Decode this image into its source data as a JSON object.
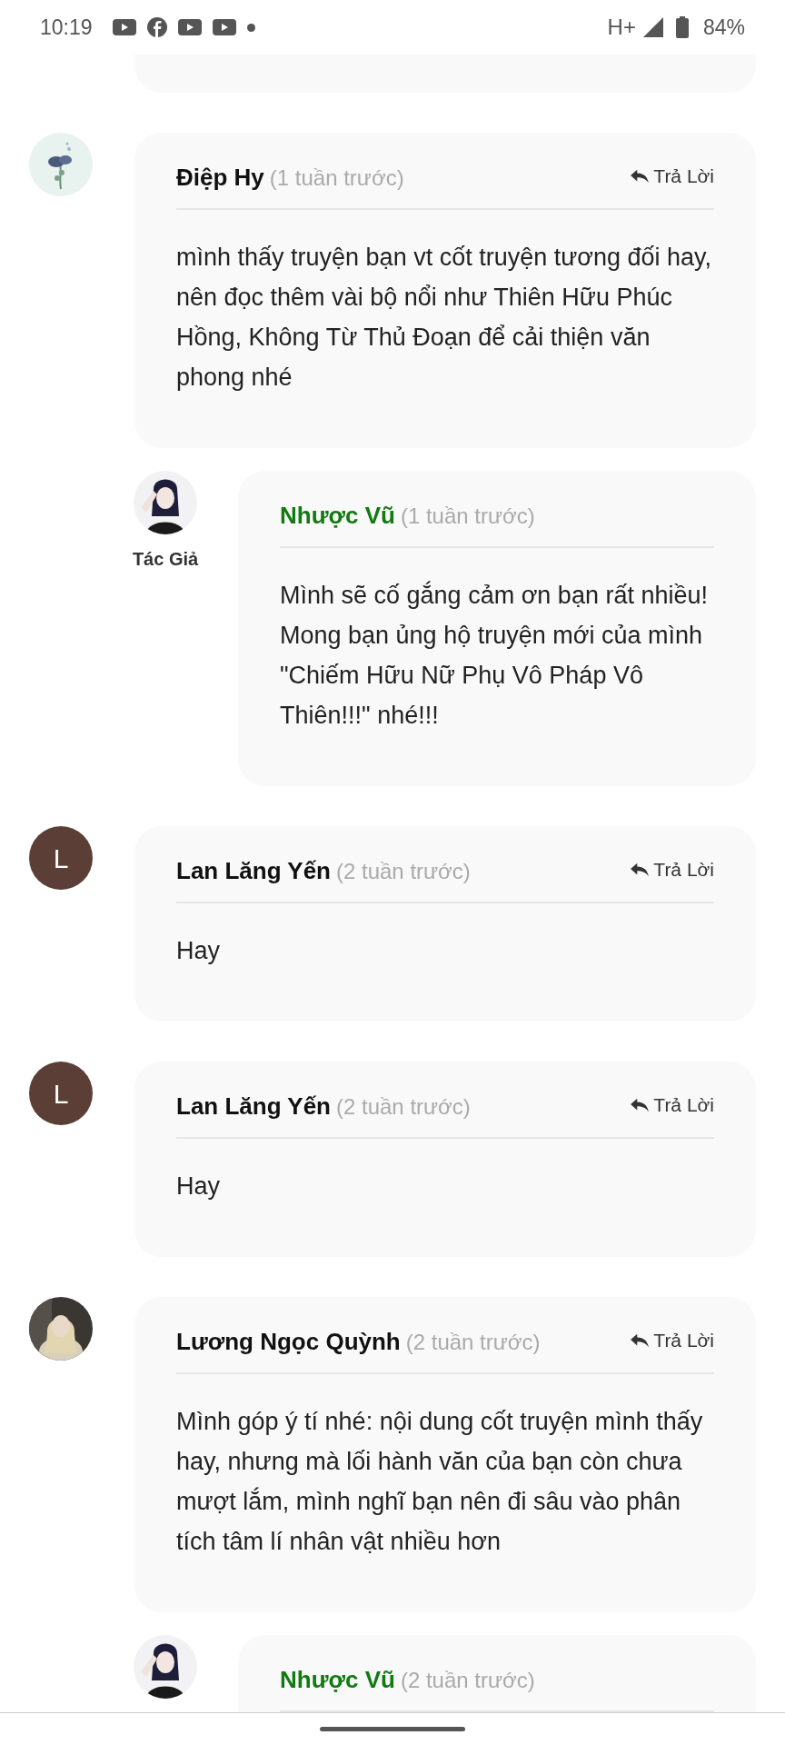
{
  "status_bar": {
    "time": "10:19",
    "network": "H+",
    "battery": "84%"
  },
  "comments": [
    {
      "author": "Điệp Hy",
      "time": "(1 tuần trước)",
      "reply_label": "Trả Lời",
      "text": "mình thấy truyện bạn vt cốt truyện tương đối hay, nên đọc thêm vài bộ nổi như Thiên Hữu Phúc Hồng, Không Từ Thủ Đoạn để cải thiện văn phong nhé",
      "replies": [
        {
          "author": "Nhược Vũ",
          "time": "(1 tuần trước)",
          "badge": "Tác Giả",
          "text": "Mình sẽ cố gắng cảm ơn bạn rất nhiều! Mong bạn ủng hộ truyện mới của mình \"Chiếm Hữu Nữ Phụ Vô Pháp Vô Thiên!!!\" nhé!!!"
        }
      ]
    },
    {
      "author": "Lan Lăng Yến",
      "time": "(2 tuần trước)",
      "reply_label": "Trả Lời",
      "avatar": {
        "kind": "letter",
        "letter": "L"
      },
      "text": "Hay"
    },
    {
      "author": "Lan Lăng Yến",
      "time": "(2 tuần trước)",
      "reply_label": "Trả Lời",
      "avatar": {
        "kind": "letter",
        "letter": "L"
      },
      "text": "Hay"
    },
    {
      "author": "Lương Ngọc Quỳnh",
      "time": "(2 tuần trước)",
      "reply_label": "Trả Lời",
      "text": "Mình góp ý tí nhé: nội dung cốt truyện mình thấy hay, nhưng mà lối hành văn của bạn còn chưa mượt lắm, mình nghĩ bạn nên đi sâu vào phân tích tâm lí nhân vật nhiều hơn",
      "replies": [
        {
          "author": "Nhược Vũ",
          "time": "(2 tuần trước)"
        }
      ]
    }
  ]
}
